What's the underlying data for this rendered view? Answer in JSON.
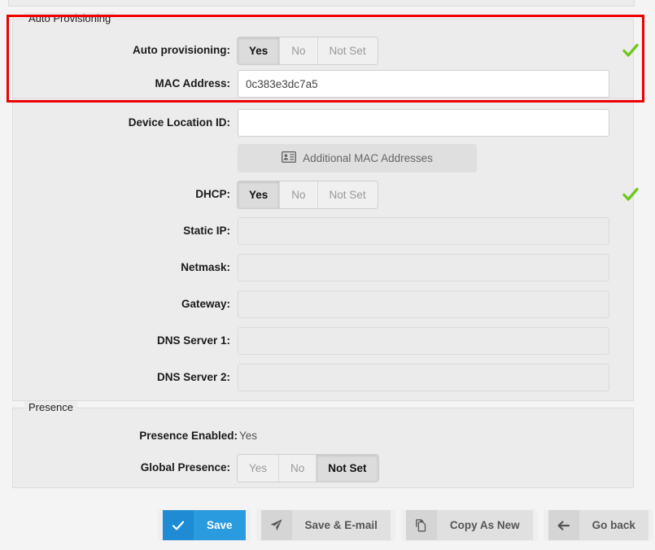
{
  "sections": {
    "auto_provisioning": {
      "legend": "Auto Provisioning",
      "rows": {
        "auto_provisioning": {
          "label": "Auto provisioning:",
          "options": [
            "Yes",
            "No",
            "Not Set"
          ],
          "selected": "Yes",
          "valid": true
        },
        "mac_address": {
          "label": "MAC Address:",
          "value": "0c383e3dc7a5",
          "placeholder": ""
        }
      }
    },
    "network": {
      "rows": {
        "device_location_id": {
          "label": "Device Location ID:",
          "value": "",
          "placeholder": ""
        },
        "additional_mac": {
          "label": "Additional MAC Addresses",
          "icon": "vcard-icon"
        },
        "dhcp": {
          "label": "DHCP:",
          "options": [
            "Yes",
            "No",
            "Not Set"
          ],
          "selected": "Yes",
          "valid": true
        },
        "static_ip": {
          "label": "Static IP:",
          "value": "",
          "placeholder": ""
        },
        "netmask": {
          "label": "Netmask:",
          "value": "",
          "placeholder": ""
        },
        "gateway": {
          "label": "Gateway:",
          "value": "",
          "placeholder": ""
        },
        "dns_server_1": {
          "label": "DNS Server 1:",
          "value": "",
          "placeholder": ""
        },
        "dns_server_2": {
          "label": "DNS Server 2:",
          "value": "",
          "placeholder": ""
        }
      }
    },
    "presence": {
      "legend": "Presence",
      "rows": {
        "presence_enabled": {
          "label": "Presence Enabled:",
          "value": "Yes"
        },
        "global_presence": {
          "label": "Global Presence:",
          "options": [
            "Yes",
            "No",
            "Not Set"
          ],
          "selected": "Not Set"
        }
      }
    }
  },
  "actions": [
    {
      "label": "Save",
      "icon": "check-icon",
      "style": "primary"
    },
    {
      "label": "Save & E-mail",
      "icon": "paper-plane-icon",
      "style": "plain"
    },
    {
      "label": "Copy As New",
      "icon": "copy-icon",
      "style": "plain"
    },
    {
      "label": "Go back",
      "icon": "arrow-left-icon",
      "style": "plain"
    }
  ],
  "colors": {
    "accent": "#2a9bdf",
    "accent_dark": "#1e8bd4",
    "valid_green": "#6ec81e",
    "highlight_red": "#ee0000",
    "panel_bg": "#ececec",
    "page_bg": "#f4f4f4"
  }
}
